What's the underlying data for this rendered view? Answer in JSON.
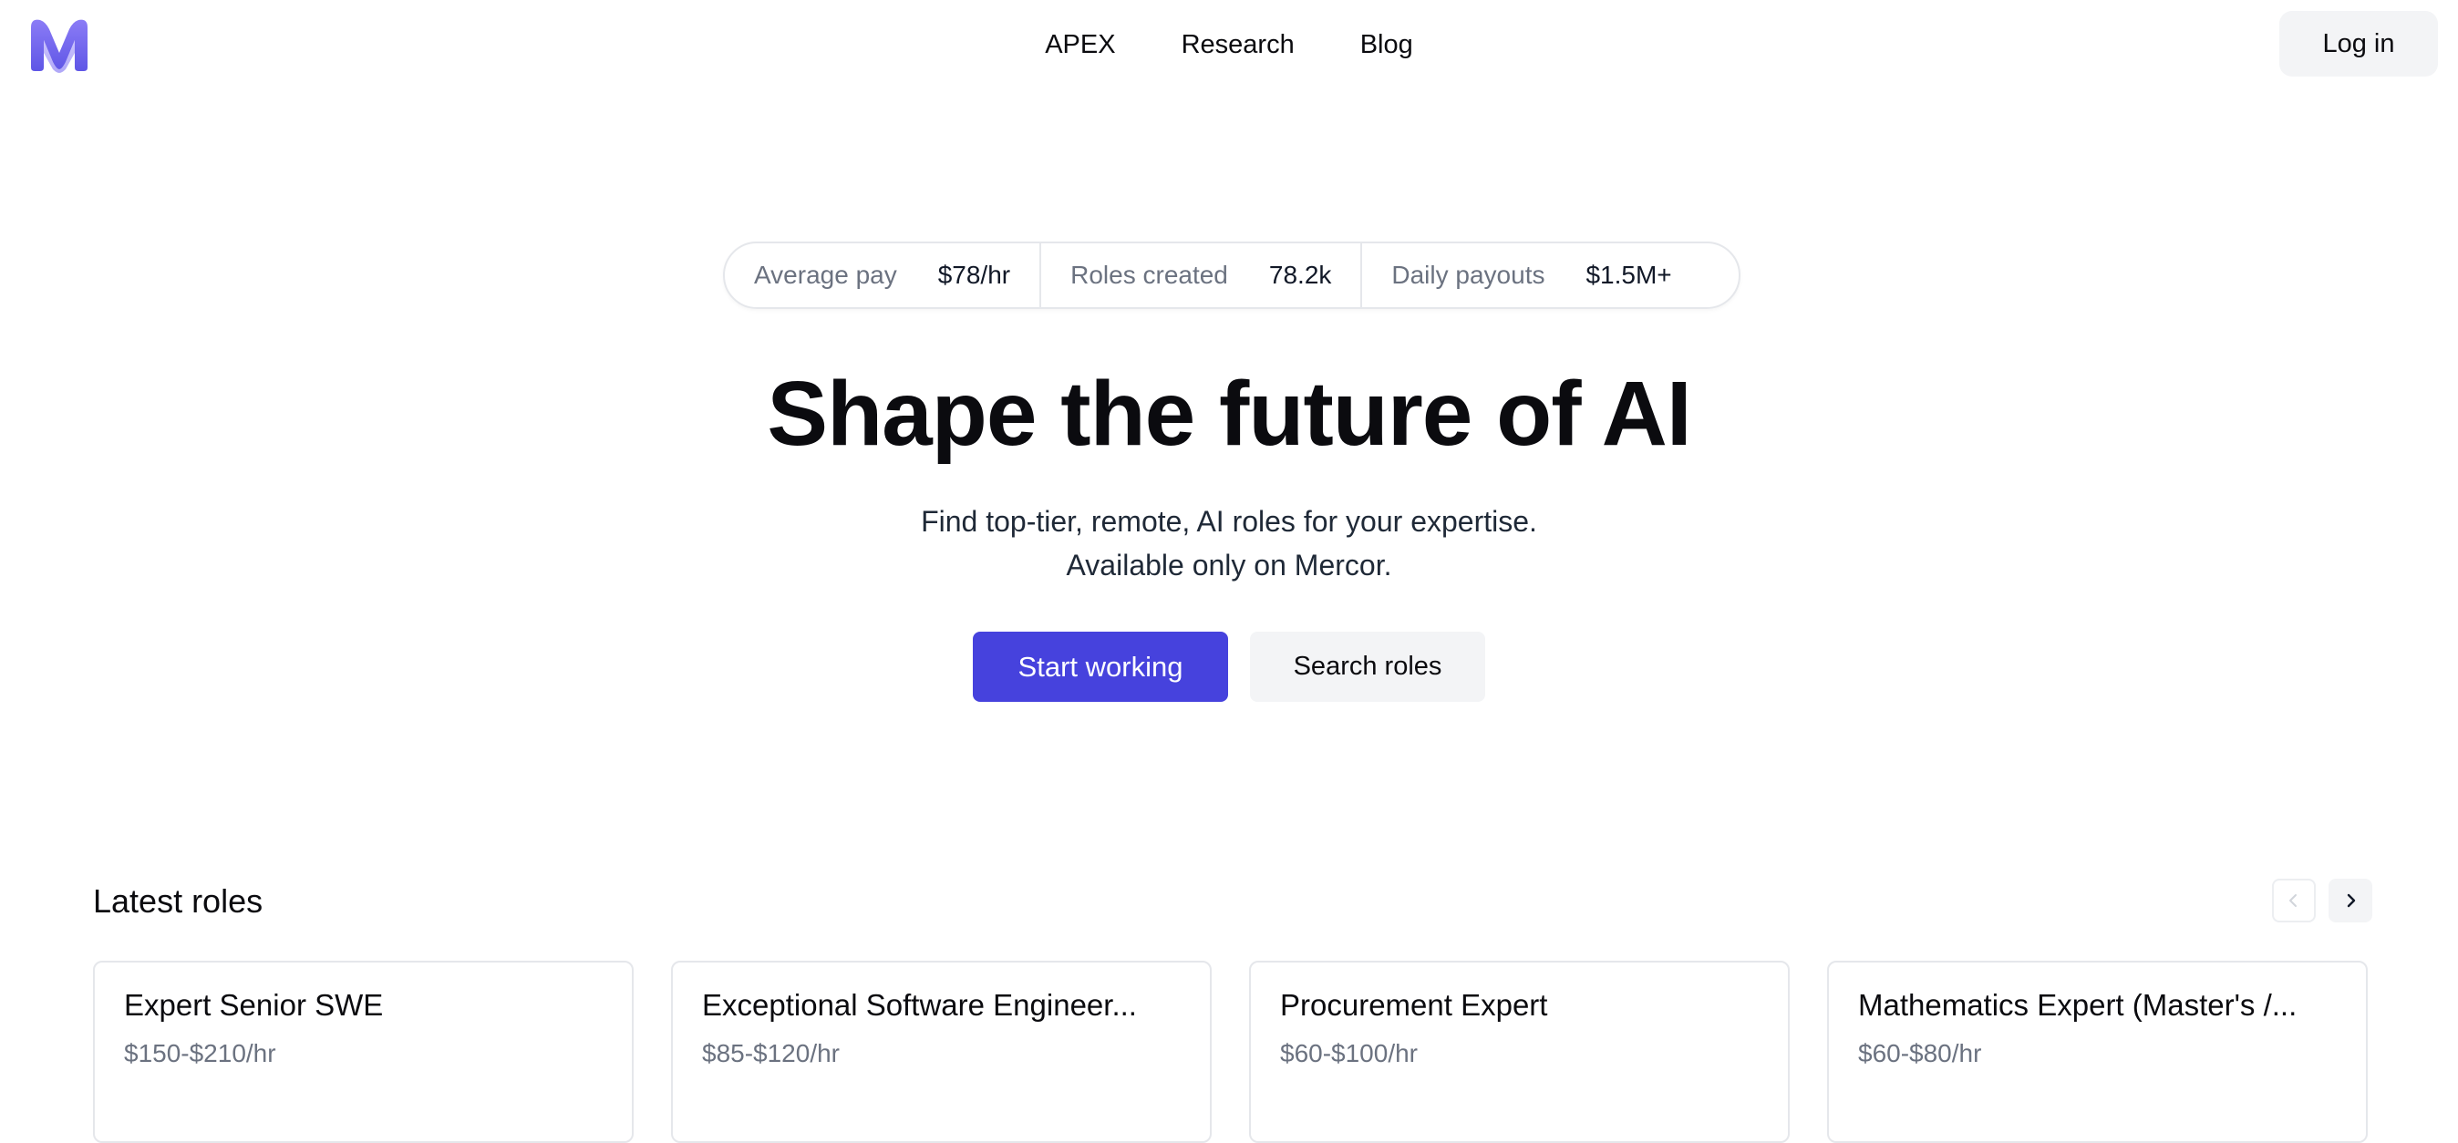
{
  "header": {
    "logo_icon": "mercor-m-logo-icon",
    "brand_color": "#6d5cf0",
    "nav": [
      {
        "label": "APEX"
      },
      {
        "label": "Research"
      },
      {
        "label": "Blog"
      }
    ],
    "login_label": "Log in"
  },
  "stats": [
    {
      "label": "Average pay",
      "value": "$78/hr"
    },
    {
      "label": "Roles created",
      "value": "78.2k"
    },
    {
      "label": "Daily payouts",
      "value": "$1.5M+"
    }
  ],
  "hero": {
    "title": "Shape the future of AI",
    "subtitle_line1": "Find top-tier, remote, AI roles for your expertise.",
    "subtitle_line2": "Available only on Mercor.",
    "primary_cta": "Start working",
    "secondary_cta": "Search roles",
    "primary_color": "#4642dd"
  },
  "roles": {
    "heading": "Latest roles",
    "prev_icon": "chevron-left-icon",
    "next_icon": "chevron-right-icon",
    "items": [
      {
        "title": "Expert Senior SWE",
        "pay": "$150-$210/hr"
      },
      {
        "title": "Exceptional Software Engineer...",
        "pay": "$85-$120/hr"
      },
      {
        "title": "Procurement Expert",
        "pay": "$60-$100/hr"
      },
      {
        "title": "Mathematics Expert (Master's /...",
        "pay": "$60-$80/hr"
      }
    ]
  }
}
